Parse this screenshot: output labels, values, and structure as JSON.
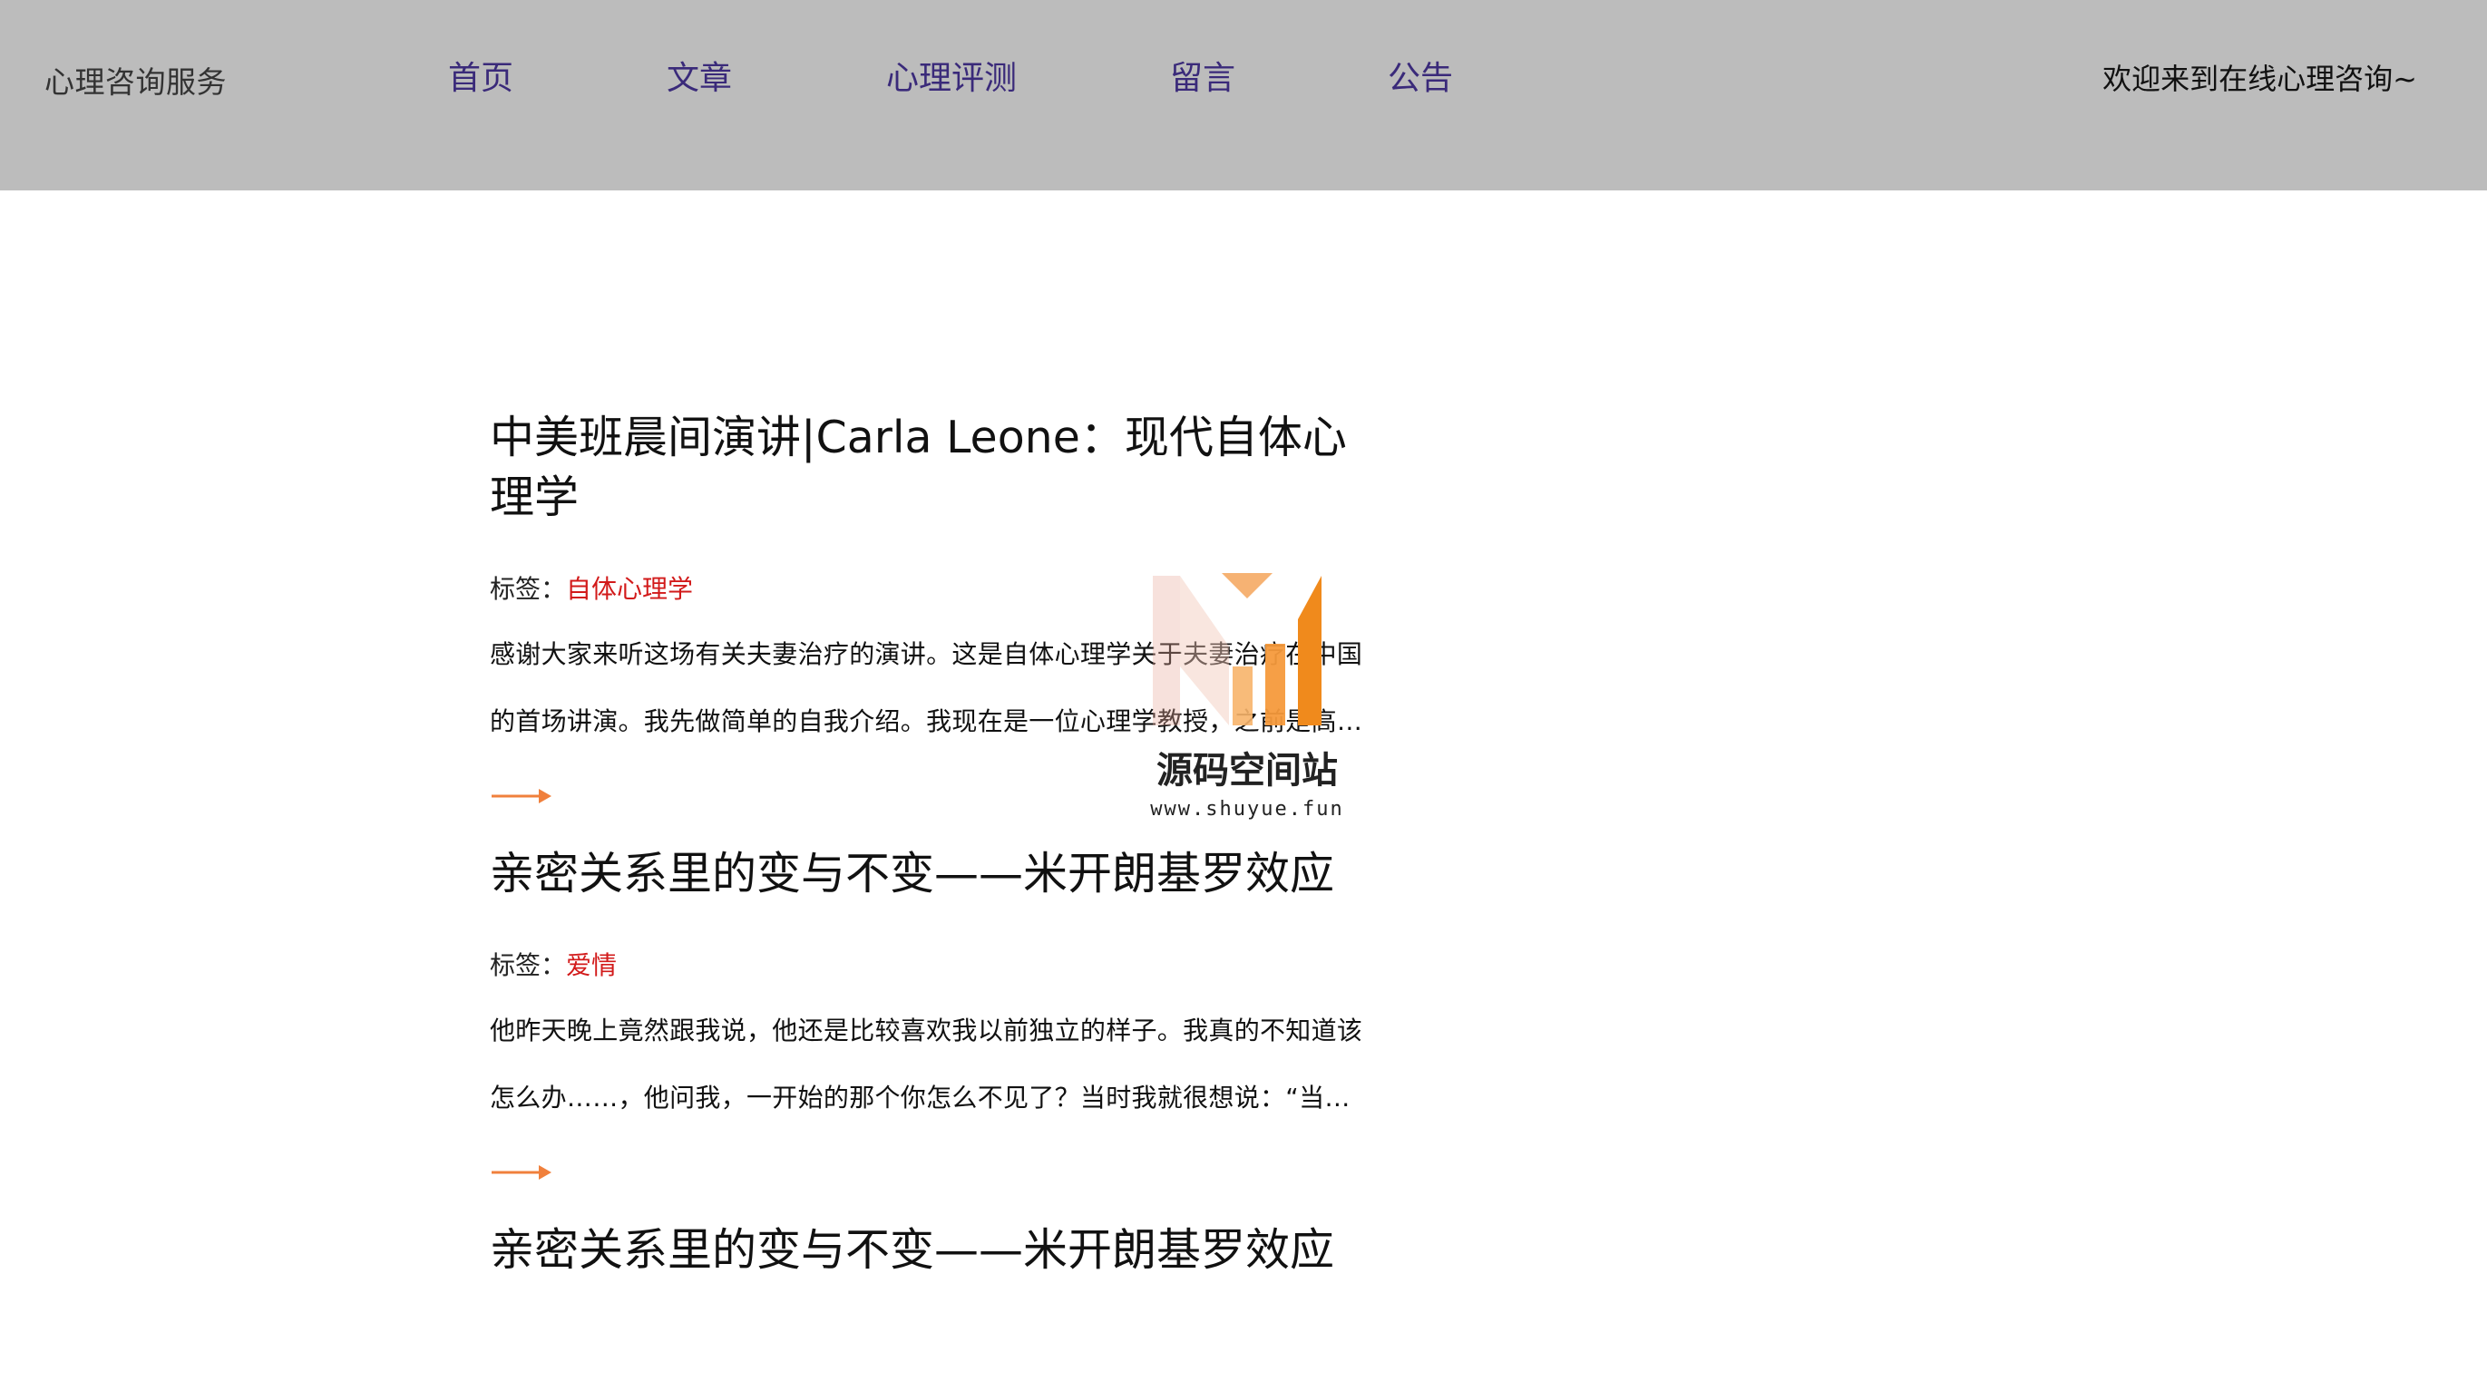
{
  "header": {
    "brand": "心理咨询服务",
    "nav": [
      {
        "label": "首页"
      },
      {
        "label": "文章"
      },
      {
        "label": "心理评测"
      },
      {
        "label": "留言"
      },
      {
        "label": "公告"
      }
    ],
    "welcome": "欢迎来到在线心理咨询~",
    "background_color": "#bcbcbc",
    "link_color": "#3a2a7a"
  },
  "articles": [
    {
      "title": "中美班晨间演讲|Carla Leone：现代自体心理学",
      "tag_label": "标签：",
      "tag": "自体心理学",
      "summary": "感谢大家来听这场有关夫妻治疗的演讲。这是自体心理学关于夫妻治疗在中国的首场讲演。我先做简单的自我介绍。我现在是一位心理学教授，之前是高…",
      "more_icon": "arrow-right-icon"
    },
    {
      "title": "亲密关系里的变与不变——米开朗基罗效应",
      "tag_label": "标签：",
      "tag": "爱情",
      "summary": "他昨天晚上竟然跟我说，他还是比较喜欢我以前独立的样子。我真的不知道该怎么办……，他问我，一开始的那个你怎么不见了？当时我就很想说：“当初…",
      "more_icon": "arrow-right-icon"
    },
    {
      "title": "亲密关系里的变与不变——米开朗基罗效应"
    }
  ],
  "watermark": {
    "title": "源码空间站",
    "url": "www.shuyue.fun"
  },
  "colors": {
    "tag": "#d21a1a",
    "accent_arrow": "#f0803c"
  }
}
